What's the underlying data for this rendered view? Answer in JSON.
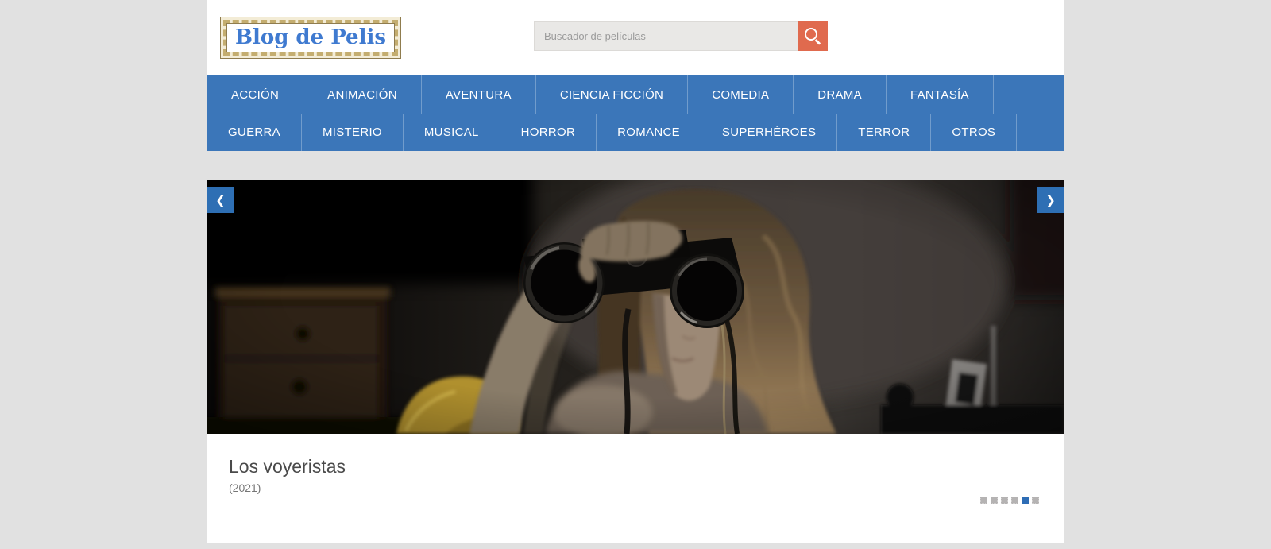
{
  "header": {
    "logo": "Blog de Pelis",
    "search": {
      "placeholder": "Buscador de películas"
    }
  },
  "nav": {
    "row1": [
      "ACCIÓN",
      "ANIMACIÓN",
      "AVENTURA",
      "CIENCIA FICCIÓN",
      "COMEDIA",
      "DRAMA",
      "FANTASÍA"
    ],
    "row2": [
      "GUERRA",
      "MISTERIO",
      "MUSICAL",
      "HORROR",
      "ROMANCE",
      "SUPERHÉROES",
      "TERROR",
      "OTROS"
    ]
  },
  "carousel": {
    "prev": "❮",
    "next": "❯",
    "slide": {
      "title": "Los voyeristas",
      "year": "(2021)"
    },
    "pagination": {
      "count": 6,
      "active_index": 4
    }
  },
  "colors": {
    "page_bg": "#e1e1e1",
    "nav_blue": "#3b76b9",
    "arrow_blue": "#2e6fb4",
    "accent_orange": "#e06a4e",
    "active_dot": "#2e6db5",
    "inactive_dot": "#b5b3b3"
  }
}
